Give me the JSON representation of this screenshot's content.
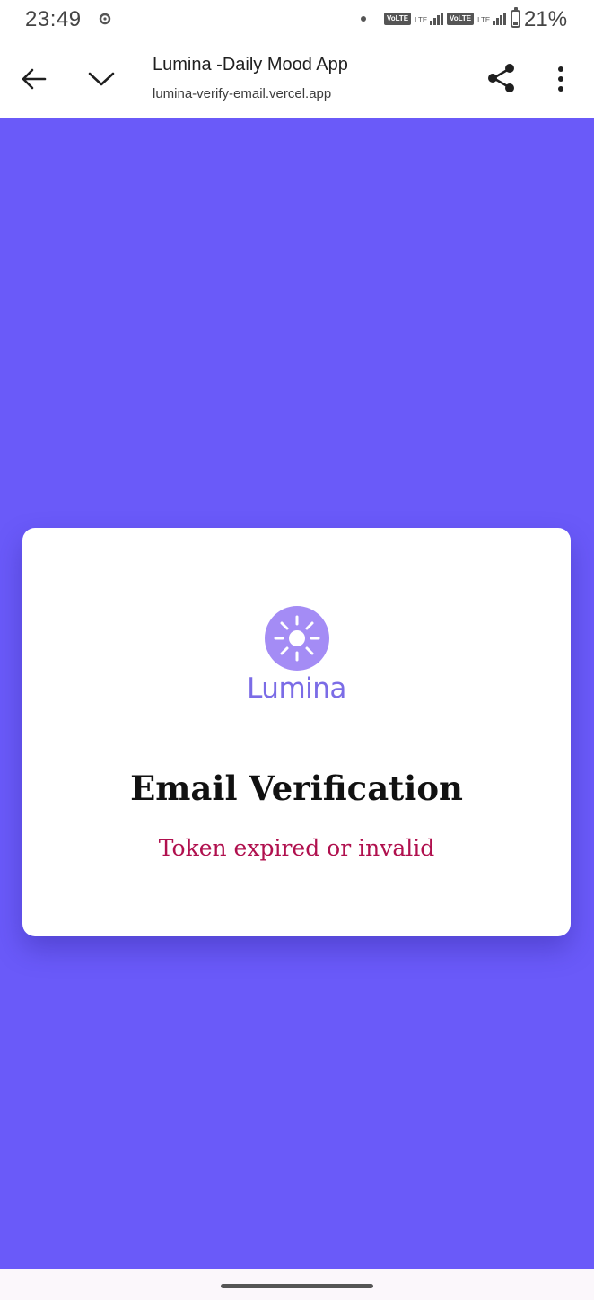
{
  "status_bar": {
    "time": "23:49",
    "network_badges": [
      "VoLTE",
      "VoLTE"
    ],
    "network_type": "LTE",
    "battery_percent": "21%",
    "battery_level": 0.21,
    "icons": [
      "gear-icon",
      "notification-dot-icon",
      "signal-icon",
      "battery-icon"
    ]
  },
  "browser": {
    "page_title": "Lumina -Daily Mood App",
    "url": "lumina-verify-email.vercel.app",
    "icons": [
      "back-arrow-icon",
      "chevron-down-icon",
      "share-icon",
      "more-vert-icon"
    ]
  },
  "card": {
    "logo_text": "Lumina",
    "logo_icon": "sun-icon",
    "title": "Email Verification",
    "message": "Token expired or invalid"
  },
  "colors": {
    "page_background": "#6a5af9",
    "logo_accent": "#a48cf5",
    "logo_text": "#7b6ce6",
    "error_text": "#b0104e"
  }
}
